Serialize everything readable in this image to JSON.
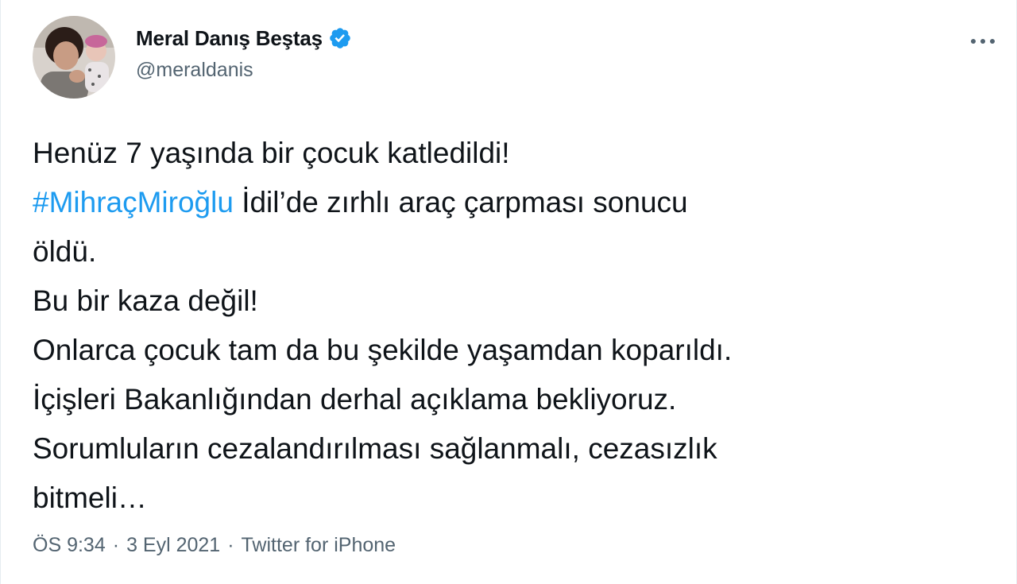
{
  "author": {
    "display_name": "Meral Danış Beştaş",
    "handle": "@meraldanis",
    "verified_icon": "verified-badge-icon",
    "accent_color": "#1d9bf0"
  },
  "tweet": {
    "line1": "Henüz 7 yaşında bir çocuk katledildi!",
    "hashtag": "#MihraçMiroğlu",
    "line2_rest": " İdil’de zırhlı araç çarpması sonucu",
    "line3": "öldü.",
    "line4": "Bu bir kaza değil!",
    "line5": "Onlarca çocuk tam da bu şekilde yaşamdan koparıldı.",
    "line6": "İçişleri Bakanlığından derhal açıklama bekliyoruz.",
    "line7": "Sorumluların cezalandırılması sağlanmalı, cezasızlık",
    "line8": "bitmeli…"
  },
  "meta": {
    "time": "ÖS 9:34",
    "separator": "·",
    "date": "3 Eyl 2021",
    "source": "Twitter for iPhone"
  },
  "menu": {
    "icon": "more-options-icon"
  }
}
